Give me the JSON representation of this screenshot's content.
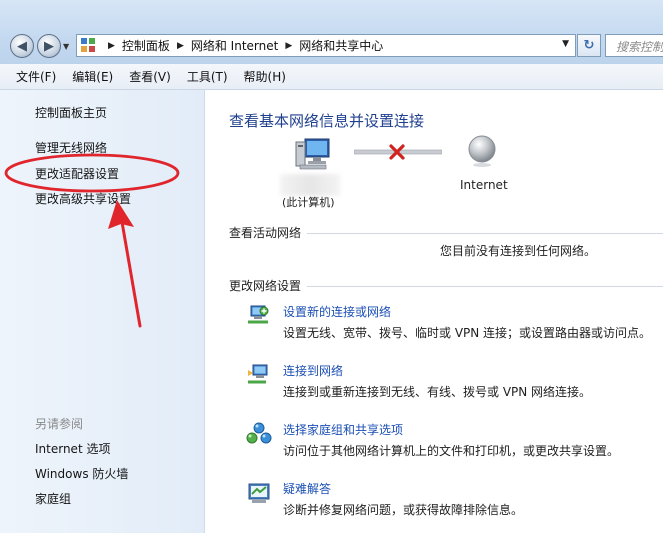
{
  "address_bar": {
    "crumbs": [
      "控制面板",
      "网络和 Internet",
      "网络和共享中心"
    ],
    "search_placeholder": "搜索控制"
  },
  "menu": [
    "文件(F)",
    "编辑(E)",
    "查看(V)",
    "工具(T)",
    "帮助(H)"
  ],
  "sidebar": {
    "links": [
      "控制面板主页",
      "管理无线网络",
      "更改适配器设置",
      "更改高级共享设置"
    ],
    "see_also_heading": "另请参阅",
    "see_also": [
      "Internet 选项",
      "Windows 防火墙",
      "家庭组"
    ]
  },
  "main": {
    "title": "查看基本网络信息并设置连接",
    "computer_label": "(此计算机)",
    "internet_label": "Internet",
    "active_networks_label": "查看活动网络",
    "no_connection": "您目前没有连接到任何网络。",
    "change_settings_label": "更改网络设置",
    "tasks": [
      {
        "link": "设置新的连接或网络",
        "desc": "设置无线、宽带、拨号、临时或 VPN 连接；或设置路由器或访问点。",
        "icon": "new-connection-icon"
      },
      {
        "link": "连接到网络",
        "desc": "连接到或重新连接到无线、有线、拨号或 VPN 网络连接。",
        "icon": "connect-network-icon"
      },
      {
        "link": "选择家庭组和共享选项",
        "desc": "访问位于其他网络计算机上的文件和打印机，或更改共享设置。",
        "icon": "homegroup-icon"
      },
      {
        "link": "疑难解答",
        "desc": "诊断并修复网络问题，或获得故障排除信息。",
        "icon": "troubleshoot-icon"
      }
    ]
  },
  "colors": {
    "link": "#1b4fb5",
    "title": "#1f3f8f",
    "annotation": "#e0262c",
    "disconnect": "#d0221e"
  }
}
